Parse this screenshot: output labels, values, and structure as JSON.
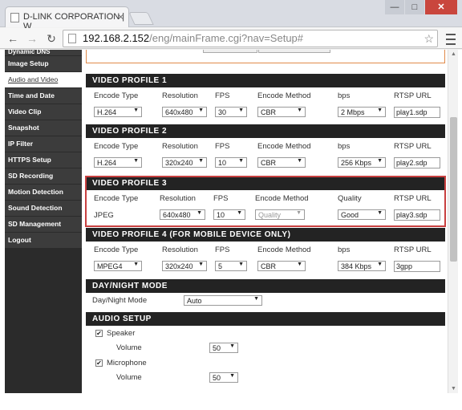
{
  "browser": {
    "tab_title": "D-LINK CORPORATION | W",
    "tab_close": "×",
    "url_host": "192.168.2.152",
    "url_path": "/eng/mainFrame.cgi?nav=Setup#",
    "window_buttons": [
      "—",
      "□",
      "✕"
    ],
    "icons": [
      "back-icon",
      "forward-icon",
      "reload-icon",
      "star-icon",
      "menu-icon"
    ]
  },
  "sidebar": {
    "items": [
      {
        "label": "Dynamic DNS"
      },
      {
        "label": "Image Setup"
      },
      {
        "label": "Audio and Video"
      },
      {
        "label": "Time and Date"
      },
      {
        "label": "Video Clip"
      },
      {
        "label": "Snapshot"
      },
      {
        "label": "IP Filter"
      },
      {
        "label": "HTTPS Setup"
      },
      {
        "label": "SD Recording"
      },
      {
        "label": "Motion Detection"
      },
      {
        "label": "Sound Detection"
      },
      {
        "label": "SD Management"
      },
      {
        "label": "Logout"
      }
    ]
  },
  "profiles": [
    {
      "title": "VIDEO PROFILE 1",
      "headers": {
        "encode_type": "Encode Type",
        "resolution": "Resolution",
        "fps": "FPS",
        "encode_method": "Encode Method",
        "rate": "bps",
        "rtsp": "RTSP URL"
      },
      "values": {
        "encode_type": "H.264",
        "resolution": "640x480",
        "fps": "30",
        "encode_method": "CBR",
        "rate": "2 Mbps",
        "rtsp": "play1.sdp"
      }
    },
    {
      "title": "VIDEO PROFILE 2",
      "headers": {
        "encode_type": "Encode Type",
        "resolution": "Resolution",
        "fps": "FPS",
        "encode_method": "Encode Method",
        "rate": "bps",
        "rtsp": "RTSP URL"
      },
      "values": {
        "encode_type": "H.264",
        "resolution": "320x240",
        "fps": "10",
        "encode_method": "CBR",
        "rate": "256 Kbps",
        "rtsp": "play2.sdp"
      }
    },
    {
      "title": "VIDEO PROFILE 3",
      "headers": {
        "encode_type": "Encode Type",
        "resolution": "Resolution",
        "fps": "FPS",
        "encode_method": "Encode Method",
        "rate": "Quality",
        "rtsp": "RTSP URL"
      },
      "values": {
        "encode_type": "JPEG",
        "resolution": "640x480",
        "fps": "10",
        "encode_method": "Quality",
        "rate": "Good",
        "rtsp": "play3.sdp"
      }
    },
    {
      "title": "VIDEO PROFILE 4 (FOR MOBILE DEVICE ONLY)",
      "headers": {
        "encode_type": "Encode Type",
        "resolution": "Resolution",
        "fps": "FPS",
        "encode_method": "Encode Method",
        "rate": "bps",
        "rtsp": "RTSP URL"
      },
      "values": {
        "encode_type": "MPEG4",
        "resolution": "320x240",
        "fps": "5",
        "encode_method": "CBR",
        "rate": "384 Kbps",
        "rtsp": "3gpp"
      }
    }
  ],
  "daynight": {
    "title": "DAY/NIGHT MODE",
    "label": "Day/Night Mode",
    "value": "Auto"
  },
  "audio": {
    "title": "AUDIO SETUP",
    "speaker_label": "Speaker",
    "speaker_volume_label": "Volume",
    "speaker_volume": "50",
    "microphone_label": "Microphone",
    "microphone_volume_label": "Volume",
    "microphone_volume": "50"
  },
  "colors": {
    "header": "#232323",
    "highlight": "#c84040",
    "sidebar": "#3c3c3c"
  }
}
